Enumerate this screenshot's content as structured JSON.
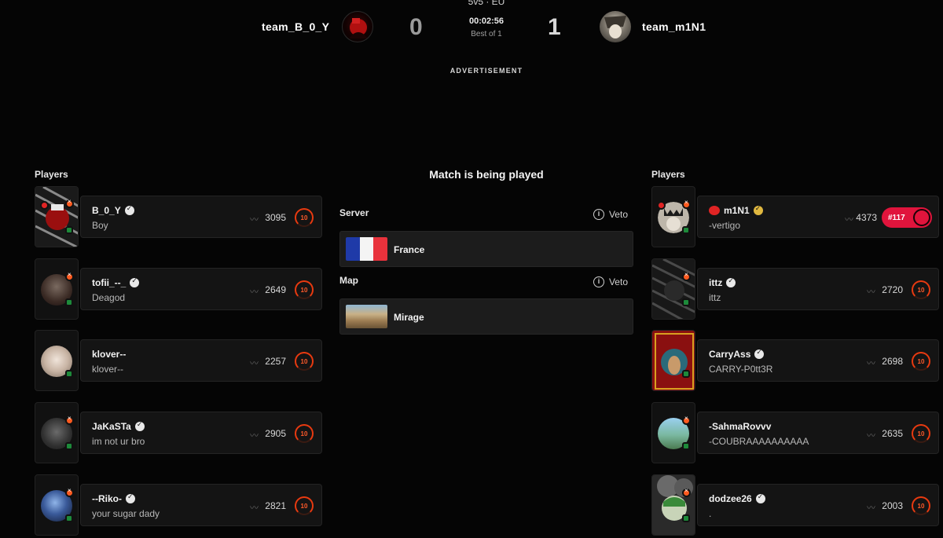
{
  "match": {
    "format": "5v5 · EU",
    "timer": "00:02:56",
    "best_of": "Best of 1",
    "status": "Match is being played",
    "advertisement": "ADVERTISEMENT"
  },
  "team1": {
    "name": "team_B_0_Y",
    "score": "0"
  },
  "team2": {
    "name": "team_m1N1",
    "score": "1"
  },
  "labels": {
    "players": "Players",
    "server": "Server",
    "map": "Map",
    "veto": "Veto"
  },
  "server": {
    "name": "France"
  },
  "map": {
    "name": "Mirage"
  },
  "team1_players": [
    {
      "name": "B_0_Y",
      "status": "Boy",
      "elo": "3095",
      "level": "10",
      "verified": true
    },
    {
      "name": "tofii_--_",
      "status": "Deagod",
      "elo": "2649",
      "level": "10",
      "verified": true
    },
    {
      "name": "klover--",
      "status": "klover--",
      "elo": "2257",
      "level": "10",
      "verified": false
    },
    {
      "name": "JaKaSTa",
      "status": "im not ur bro",
      "elo": "2905",
      "level": "10",
      "verified": true
    },
    {
      "name": "--Riko-",
      "status": "your sugar dady",
      "elo": "2821",
      "level": "10",
      "verified": true
    }
  ],
  "team2_players": [
    {
      "name": "m1N1",
      "status": "-vertigo",
      "elo": "4373",
      "rank": "#117",
      "verified": true
    },
    {
      "name": "ittz",
      "status": "ittz",
      "elo": "2720",
      "level": "10",
      "verified": true
    },
    {
      "name": "CarryAss",
      "status": "CARRY-P0tt3R",
      "elo": "2698",
      "level": "10",
      "verified": true
    },
    {
      "name": "-SahmaRovvv",
      "status": "-COUBRAAAAAAAAAA",
      "elo": "2635",
      "level": "10",
      "verified": false
    },
    {
      "name": "dodzee26",
      "status": ".",
      "elo": "2003",
      "level": "10",
      "verified": true
    }
  ],
  "colors": {
    "background": "#050505",
    "card": "#141414",
    "level_accent": "#e83a10",
    "rank_pill": "#e0143c"
  },
  "icons": [
    "info-icon",
    "verified-icon",
    "trend-icon",
    "level-icon",
    "france-flag"
  ]
}
